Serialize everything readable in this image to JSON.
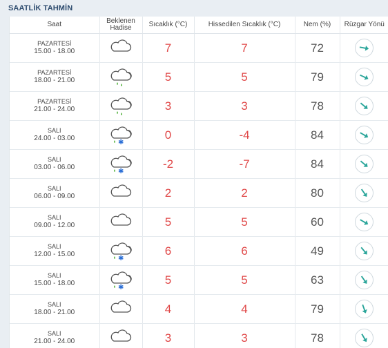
{
  "section_title": "SAATLİK TAHMİN",
  "headers": {
    "saat": "Saat",
    "hadise": "Beklenen Hadise",
    "sicaklik": "Sıcaklık (°C)",
    "hissedilen": "Hissedilen Sıcaklık (°C)",
    "nem": "Nem (%)",
    "ruzgar": "Rüzgar Yönü"
  },
  "colors": {
    "title": "#2d4b6e",
    "temp": "#e04848",
    "wind_arrow": "#2aa59a",
    "rain": "#5fb84a",
    "snow": "#2b6fd6"
  },
  "rows": [
    {
      "day": "PAZARTESİ",
      "time": "15.00 - 18.00",
      "icon": "cloudy-icon",
      "temp": "7",
      "feels": "7",
      "humidity": "72",
      "wind_deg": 10
    },
    {
      "day": "PAZARTESİ",
      "time": "18.00 - 21.00",
      "icon": "rain-icon",
      "temp": "5",
      "feels": "5",
      "humidity": "79",
      "wind_deg": 25
    },
    {
      "day": "PAZARTESİ",
      "time": "21.00 - 24.00",
      "icon": "rain-icon",
      "temp": "3",
      "feels": "3",
      "humidity": "78",
      "wind_deg": 40
    },
    {
      "day": "SALI",
      "time": "24.00 - 03.00",
      "icon": "rain-snow-icon",
      "temp": "0",
      "feels": "-4",
      "humidity": "84",
      "wind_deg": 30
    },
    {
      "day": "SALI",
      "time": "03.00 - 06.00",
      "icon": "rain-snow-icon",
      "temp": "-2",
      "feels": "-7",
      "humidity": "84",
      "wind_deg": 40
    },
    {
      "day": "SALI",
      "time": "06.00 - 09.00",
      "icon": "cloudy-icon",
      "temp": "2",
      "feels": "2",
      "humidity": "80",
      "wind_deg": 55
    },
    {
      "day": "SALI",
      "time": "09.00 - 12.00",
      "icon": "cloudy-icon",
      "temp": "5",
      "feels": "5",
      "humidity": "60",
      "wind_deg": 30
    },
    {
      "day": "SALI",
      "time": "12.00 - 15.00",
      "icon": "rain-snow-icon",
      "temp": "6",
      "feels": "6",
      "humidity": "49",
      "wind_deg": 50
    },
    {
      "day": "SALI",
      "time": "15.00 - 18.00",
      "icon": "rain-snow-icon",
      "temp": "5",
      "feels": "5",
      "humidity": "63",
      "wind_deg": 55
    },
    {
      "day": "SALI",
      "time": "18.00 - 21.00",
      "icon": "cloudy-icon",
      "temp": "4",
      "feels": "4",
      "humidity": "79",
      "wind_deg": 70
    },
    {
      "day": "SALI",
      "time": "21.00 - 24.00",
      "icon": "cloudy-icon",
      "temp": "3",
      "feels": "3",
      "humidity": "78",
      "wind_deg": 60
    }
  ]
}
